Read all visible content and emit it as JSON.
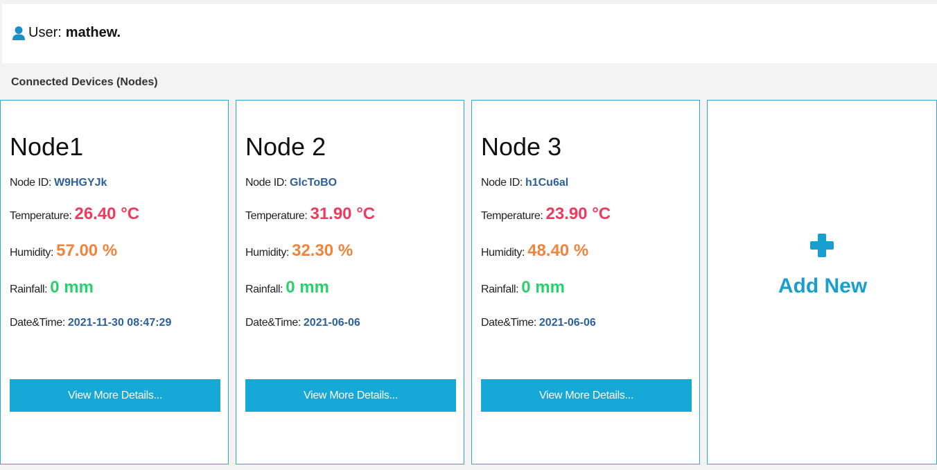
{
  "header": {
    "user_label": "User:",
    "user_name": "mathew."
  },
  "section_title": "Connected Devices (Nodes)",
  "labels": {
    "node_id": "Node ID:",
    "temperature": "Temperature:",
    "humidity": "Humidity:",
    "rainfall": "Rainfall:",
    "datetime": "Date&Time:",
    "button": "View More Details..."
  },
  "nodes": [
    {
      "title": "Node1",
      "id": "W9HGYJk",
      "temperature": "26.40 °C",
      "humidity": "57.00 %",
      "rainfall": "0 mm",
      "datetime": "2021-11-30 08:47:29"
    },
    {
      "title": "Node 2",
      "id": "GlcToBO",
      "temperature": "31.90 °C",
      "humidity": "32.30 %",
      "rainfall": "0 mm",
      "datetime": "2021-06-06"
    },
    {
      "title": "Node 3",
      "id": "h1Cu6al",
      "temperature": "23.90 °C",
      "humidity": "48.40 %",
      "rainfall": "0 mm",
      "datetime": "2021-06-06"
    }
  ],
  "add_new": {
    "label": "Add New",
    "icon": "plus-icon"
  },
  "icons": {
    "user": "user-icon"
  },
  "colors": {
    "accent": "#16a8d6",
    "node_id": "#2d5f99",
    "temperature": "#ef3a5d",
    "humidity": "#f0843c",
    "rainfall": "#27d26b"
  }
}
